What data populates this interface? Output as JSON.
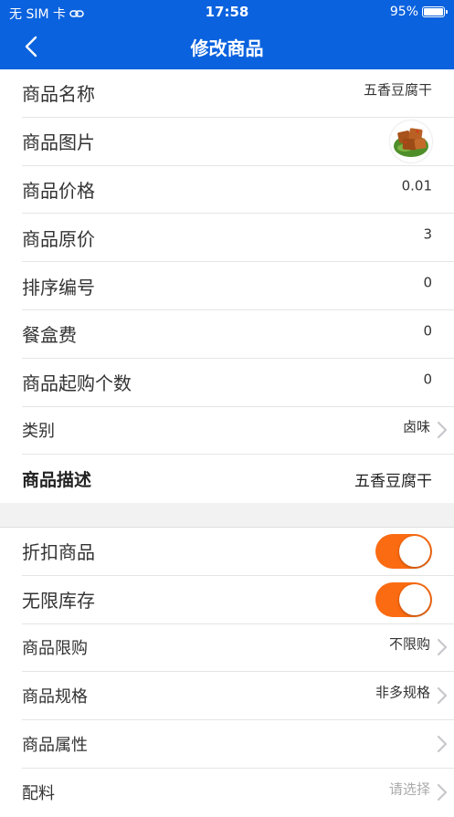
{
  "status_bar": {
    "carrier": "无 SIM 卡",
    "time": "17:58",
    "battery": "95%"
  },
  "nav": {
    "title": "修改商品",
    "back_icon": "chevron-left-icon"
  },
  "section1": {
    "name_label": "商品名称",
    "name_value": "五香豆腐干",
    "image_label": "商品图片",
    "price_label": "商品价格",
    "price_value": "0.01",
    "orig_price_label": "商品原价",
    "orig_price_value": "3",
    "sort_label": "排序编号",
    "sort_value": "0",
    "box_fee_label": "餐盒费",
    "box_fee_value": "0",
    "min_buy_label": "商品起购个数",
    "min_buy_value": "0",
    "category_label": "类别",
    "category_value": "卤味",
    "desc_label": "商品描述",
    "desc_value": "五香豆腐干"
  },
  "section2": {
    "discount_label": "折扣商品",
    "discount_on": true,
    "unlimited_stock_label": "无限库存",
    "unlimited_stock_on": true,
    "limit_label": "商品限购",
    "limit_value": "不限购",
    "spec_label": "商品规格",
    "spec_value": "非多规格",
    "attr_label": "商品属性",
    "ingredients_label": "配料",
    "ingredients_placeholder": "请选择"
  },
  "colors": {
    "header_blue": "#0a62de",
    "toggle_orange": "#fb6b12"
  }
}
